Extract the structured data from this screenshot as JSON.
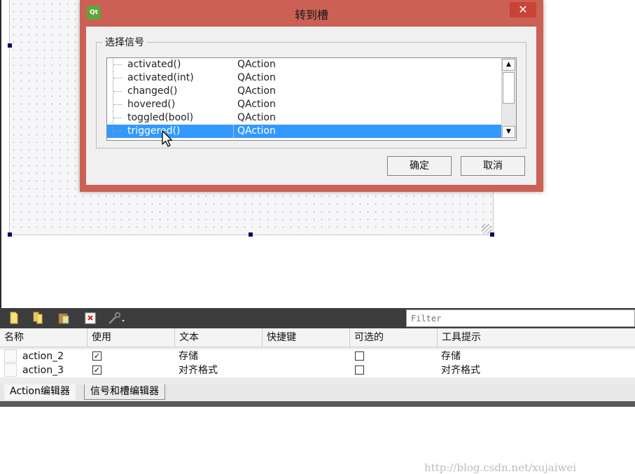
{
  "dialog": {
    "title": "转到槽",
    "close_label": "✕",
    "app_icon_text": "Qt",
    "group_label": "选择信号",
    "signals": [
      {
        "signal": "activated()",
        "class": "QAction",
        "selected": false
      },
      {
        "signal": "activated(int)",
        "class": "QAction",
        "selected": false
      },
      {
        "signal": "changed()",
        "class": "QAction",
        "selected": false
      },
      {
        "signal": "hovered()",
        "class": "QAction",
        "selected": false
      },
      {
        "signal": "toggled(bool)",
        "class": "QAction",
        "selected": false
      },
      {
        "signal": "triggered()",
        "class": "QAction",
        "selected": true
      }
    ],
    "scroll_up": "▲",
    "scroll_down": "▼",
    "ok_label": "确定",
    "cancel_label": "取消"
  },
  "action_editor": {
    "filter_placeholder": "Filter",
    "toolbar_icons": [
      "new-action-icon",
      "copy-action-icon",
      "paste-action-icon",
      "delete-action-icon",
      "configure-icon"
    ],
    "columns": [
      "名称",
      "使用",
      "文本",
      "快捷键",
      "可选的",
      "工具提示"
    ],
    "rows": [
      {
        "name": "action_2",
        "used": "✓",
        "text": "存储",
        "shortcut": "",
        "checkable": "",
        "tooltip": "存储"
      },
      {
        "name": "action_3",
        "used": "✓",
        "text": "对齐格式",
        "shortcut": "",
        "checkable": "",
        "tooltip": "对齐格式"
      }
    ],
    "tabs": [
      "Action编辑器",
      "信号和槽编辑器"
    ]
  },
  "watermark": "http://blog.csdn.net/xujaiwei",
  "colors": {
    "dialog_frame": "#cc6055",
    "selection": "#3399ff",
    "toolbar_bg": "#3c3c3c"
  }
}
